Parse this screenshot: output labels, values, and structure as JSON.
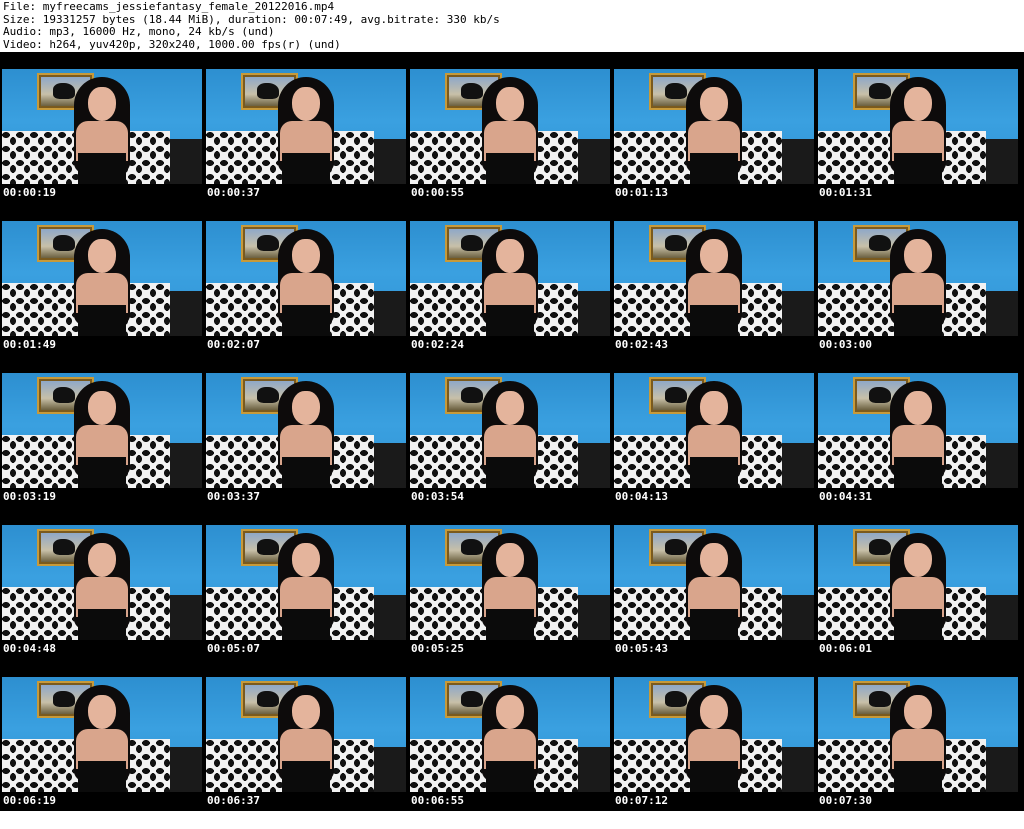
{
  "header": {
    "file": "File: myfreecams_jessiefantasy_female_20122016.mp4",
    "size": "Size: 19331257 bytes (18.44 MiB), duration: 00:07:49, avg.bitrate: 330 kb/s",
    "audio": "Audio: mp3, 16000 Hz, mono, 24 kb/s (und)",
    "video": "Video: h264, yuv420p, 320x240, 1000.00 fps(r) (und)"
  },
  "thumbnails": [
    {
      "timestamp": "00:00:19"
    },
    {
      "timestamp": "00:00:37"
    },
    {
      "timestamp": "00:00:55"
    },
    {
      "timestamp": "00:01:13"
    },
    {
      "timestamp": "00:01:31"
    },
    {
      "timestamp": "00:01:49"
    },
    {
      "timestamp": "00:02:07"
    },
    {
      "timestamp": "00:02:24"
    },
    {
      "timestamp": "00:02:43"
    },
    {
      "timestamp": "00:03:00"
    },
    {
      "timestamp": "00:03:19"
    },
    {
      "timestamp": "00:03:37"
    },
    {
      "timestamp": "00:03:54"
    },
    {
      "timestamp": "00:04:13"
    },
    {
      "timestamp": "00:04:31"
    },
    {
      "timestamp": "00:04:48"
    },
    {
      "timestamp": "00:05:07"
    },
    {
      "timestamp": "00:05:25"
    },
    {
      "timestamp": "00:05:43"
    },
    {
      "timestamp": "00:06:01"
    },
    {
      "timestamp": "00:06:19"
    },
    {
      "timestamp": "00:06:37"
    },
    {
      "timestamp": "00:06:55"
    },
    {
      "timestamp": "00:07:12"
    },
    {
      "timestamp": "00:07:30"
    }
  ]
}
